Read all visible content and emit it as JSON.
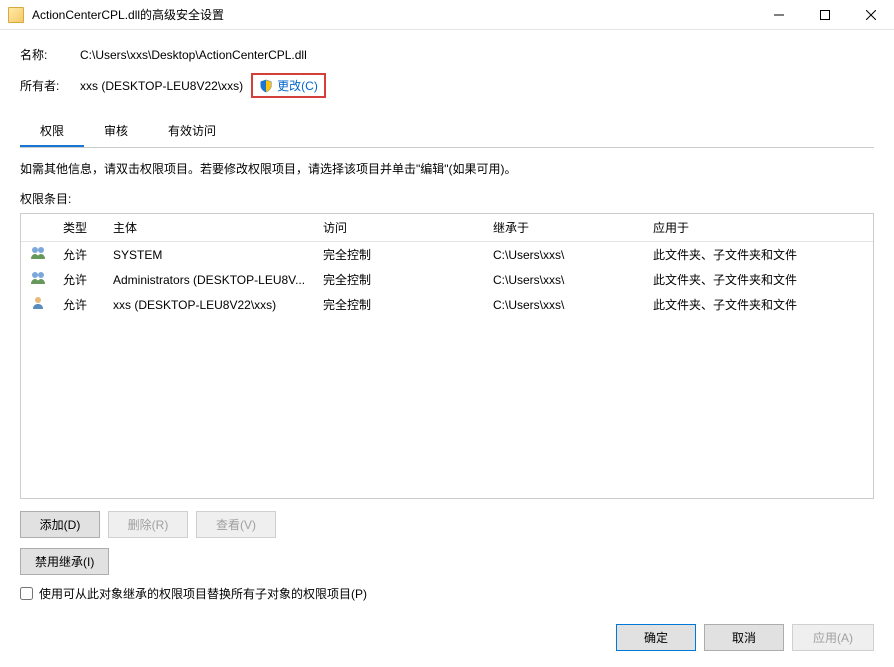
{
  "window": {
    "title": "ActionCenterCPL.dll的高级安全设置"
  },
  "info": {
    "name_label": "名称:",
    "name_value": "C:\\Users\\xxs\\Desktop\\ActionCenterCPL.dll",
    "owner_label": "所有者:",
    "owner_value": "xxs (DESKTOP-LEU8V22\\xxs)",
    "change_label": "更改(C)"
  },
  "tabs": [
    {
      "label": "权限",
      "active": true
    },
    {
      "label": "审核",
      "active": false
    },
    {
      "label": "有效访问",
      "active": false
    }
  ],
  "help_text": "如需其他信息，请双击权限项目。若要修改权限项目，请选择该项目并单击\"编辑\"(如果可用)。",
  "entries_label": "权限条目:",
  "table": {
    "headers": {
      "type": "类型",
      "principal": "主体",
      "access": "访问",
      "inherited_from": "继承于",
      "applies_to": "应用于"
    },
    "rows": [
      {
        "type": "允许",
        "principal": "SYSTEM",
        "access": "完全控制",
        "inherited_from": "C:\\Users\\xxs\\",
        "applies_to": "此文件夹、子文件夹和文件"
      },
      {
        "type": "允许",
        "principal": "Administrators (DESKTOP-LEU8V...",
        "access": "完全控制",
        "inherited_from": "C:\\Users\\xxs\\",
        "applies_to": "此文件夹、子文件夹和文件"
      },
      {
        "type": "允许",
        "principal": "xxs (DESKTOP-LEU8V22\\xxs)",
        "access": "完全控制",
        "inherited_from": "C:\\Users\\xxs\\",
        "applies_to": "此文件夹、子文件夹和文件"
      }
    ]
  },
  "buttons": {
    "add": "添加(D)",
    "remove": "删除(R)",
    "view": "查看(V)",
    "disable_inherit": "禁用继承(I)"
  },
  "checkbox": {
    "replace_label": "使用可从此对象继承的权限项目替换所有子对象的权限项目(P)"
  },
  "footer": {
    "ok": "确定",
    "cancel": "取消",
    "apply": "应用(A)"
  }
}
